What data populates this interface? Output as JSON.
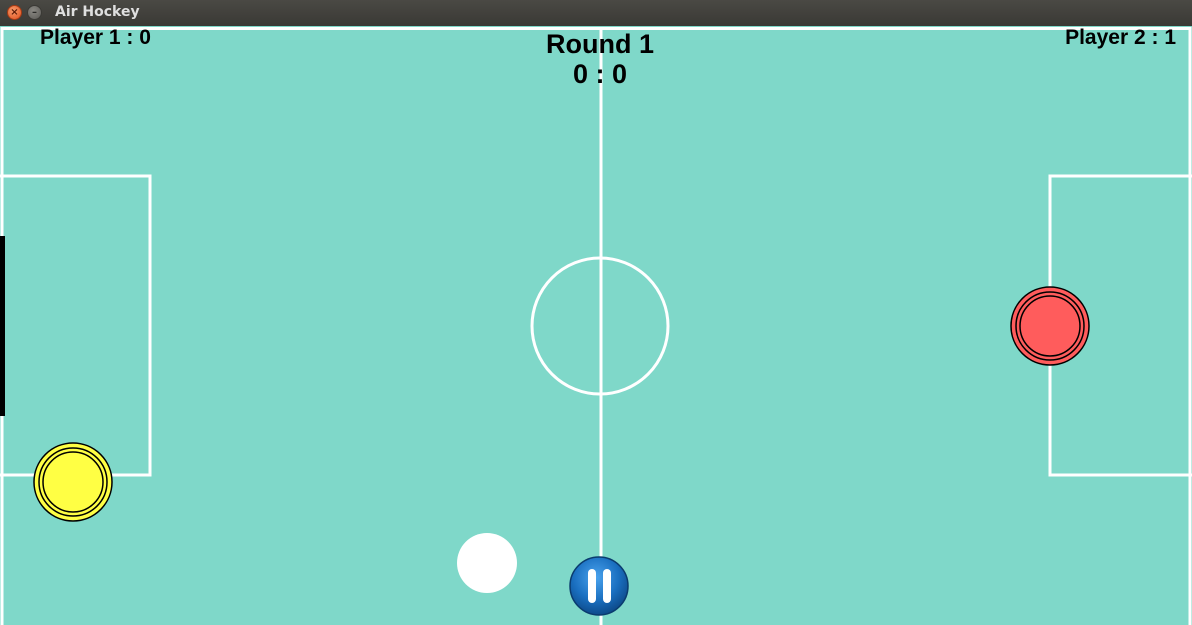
{
  "window": {
    "title": "Air Hockey",
    "close_glyph": "×",
    "minimize_glyph": "–"
  },
  "hud": {
    "player1_score": "Player 1 : 0",
    "player2_score": "Player 2 : 1",
    "round_title": "Round 1",
    "round_score": "0 : 0"
  },
  "colors": {
    "table": "#7fd8c9",
    "lines": "#ffffff",
    "player1_mallet": "#ffff44",
    "player2_mallet": "#ff5c5c",
    "puck": "#ffffff",
    "pause_button": "#1a6fc0"
  },
  "icons": {
    "pause": "pause-icon"
  }
}
